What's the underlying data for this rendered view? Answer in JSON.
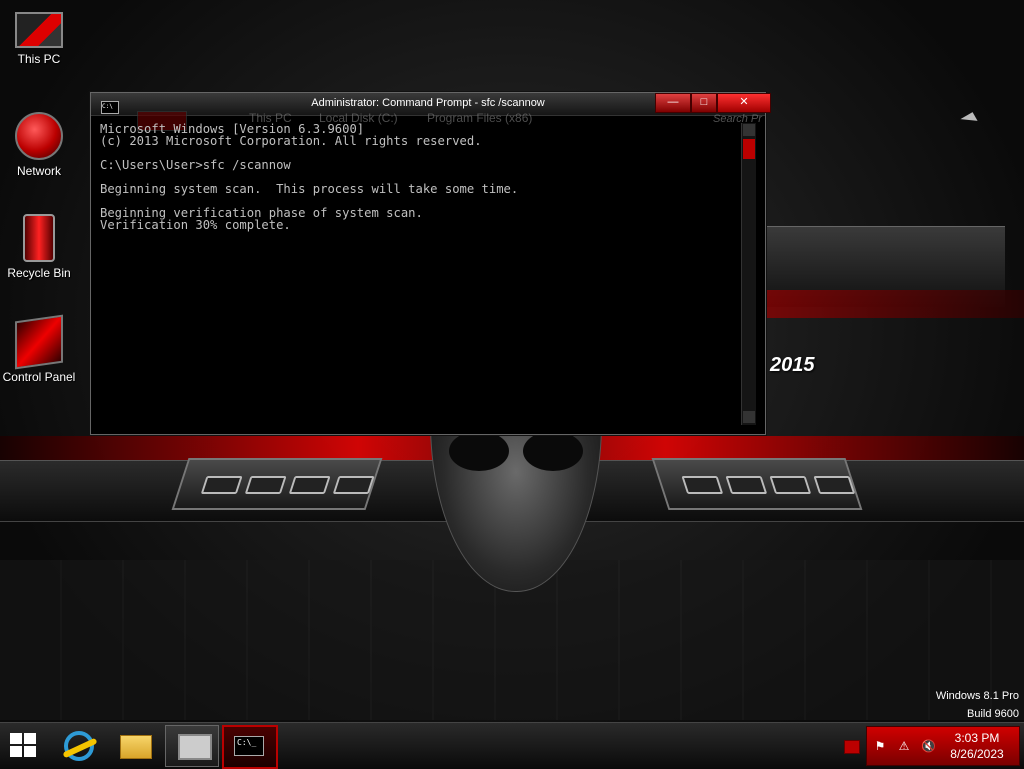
{
  "desktop": {
    "icons": [
      {
        "label": "This PC"
      },
      {
        "label": "Network"
      },
      {
        "label": "Recycle Bin"
      },
      {
        "label": "Control Panel"
      }
    ],
    "wallpaper_text": "2015"
  },
  "cmd_window": {
    "title": "Administrator: Command Prompt - sfc  /scannow",
    "system_icon": "C:\\",
    "output_lines": [
      "Microsoft Windows [Version 6.3.9600]",
      "(c) 2013 Microsoft Corporation. All rights reserved.",
      "",
      "C:\\Users\\User>sfc /scannow",
      "",
      "Beginning system scan.  This process will take some time.",
      "",
      "Beginning verification phase of system scan.",
      "Verification 30% complete."
    ],
    "buttons": {
      "minimize": "—",
      "maximize": "□",
      "close": "✕"
    },
    "background_explorer": {
      "breadcrumb": [
        "This PC",
        "Local Disk (C:)",
        "Program Files (x86)"
      ],
      "search_placeholder": "Search Pr"
    }
  },
  "watermark": {
    "line1": "Windows 8.1 Pro",
    "line2": "Build 9600"
  },
  "taskbar": {
    "buttons": [
      {
        "name": "start",
        "icon": "windows-logo-icon"
      },
      {
        "name": "internet-explorer",
        "icon": "ie-icon"
      },
      {
        "name": "file-explorer",
        "icon": "folder-icon"
      },
      {
        "name": "monitor",
        "icon": "monitor-icon"
      },
      {
        "name": "command-prompt",
        "icon": "cmd-icon",
        "label": "C:\\_"
      }
    ],
    "tray": {
      "time": "3:03 PM",
      "date": "8/26/2023"
    }
  },
  "colors": {
    "accent": "#cc0000",
    "console_text": "#c0c0c0",
    "console_bg": "#000000"
  }
}
